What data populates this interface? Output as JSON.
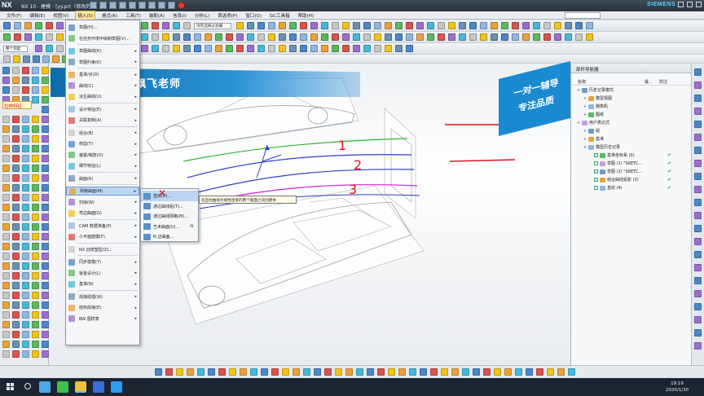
{
  "window": {
    "logo": "NX",
    "title": "NX 10 - 建模 - [yy.prt（修改的）]",
    "brand": "SIEMENS"
  },
  "menubar": {
    "items": [
      {
        "label": "文件(F)"
      },
      {
        "label": "编辑(E)"
      },
      {
        "label": "视图(V)"
      },
      {
        "label": "插入(S)",
        "active": true
      },
      {
        "label": "格式(R)"
      },
      {
        "label": "工具(T)"
      },
      {
        "label": "装配(A)"
      },
      {
        "label": "信息(I)"
      },
      {
        "label": "分析(L)"
      },
      {
        "label": "首选项(P)"
      },
      {
        "label": "窗口(O)"
      },
      {
        "label": "GC工具箱"
      },
      {
        "label": "帮助(H)"
      }
    ]
  },
  "toolbar": {
    "selection_filter": "没有选择过滤器",
    "assembly_scope": "整个装配"
  },
  "leftpalette": {
    "tooltip": "拉伸特征"
  },
  "insert_menu": {
    "items": [
      {
        "label": "草图(H)...",
        "sub": false
      },
      {
        "label": "在任务环境中绘制草图(V)...",
        "sub": false
      },
      {
        "label": "草图曲线(K)",
        "sub": true
      },
      {
        "label": "草图约束(K)",
        "sub": true
      },
      {
        "label": "基准/点(D)",
        "sub": true
      },
      {
        "label": "曲线(C)",
        "sub": true
      },
      {
        "label": "派生曲线(U)",
        "sub": true
      },
      {
        "label": "设计特征(E)",
        "sub": true
      },
      {
        "label": "关联复制(A)",
        "sub": true
      },
      {
        "label": "组合(B)",
        "sub": true
      },
      {
        "label": "修剪(T)",
        "sub": true
      },
      {
        "label": "偏置/缩放(O)",
        "sub": true
      },
      {
        "label": "细节特征(L)",
        "sub": true
      },
      {
        "label": "曲面(R)",
        "sub": true
      },
      {
        "label": "网格曲面(M)",
        "sub": true,
        "highlight": true
      },
      {
        "label": "扫掠(W)",
        "sub": true
      },
      {
        "label": "弯边曲面(G)",
        "sub": true
      },
      {
        "label": "CAM 数据准备(P)",
        "sub": true
      },
      {
        "label": "小平面建模(F)",
        "sub": true
      },
      {
        "label": "NX 创意塑型(Z)...",
        "sub": false
      },
      {
        "label": "同步建模(Y)",
        "sub": true
      },
      {
        "label": "钣金设计(L)",
        "sub": true
      },
      {
        "label": "基准(N)",
        "sub": true
      },
      {
        "label": "焊接助理(W)",
        "sub": true
      },
      {
        "label": "结构焊接(E)",
        "sub": true
      },
      {
        "label": "BW 图样表",
        "sub": true
      }
    ]
  },
  "mesh_submenu": {
    "items": [
      {
        "label": "直纹(R)...",
        "key": "",
        "highlight": true
      },
      {
        "label": "通过曲线组(T)...",
        "key": ""
      },
      {
        "label": "通过曲线网格(M)...",
        "key": ""
      },
      {
        "label": "艺术曲面(U)...",
        "key": "N"
      },
      {
        "label": "N 边曲面..."
      }
    ]
  },
  "tooltip": "在直纹曲线为线性连接的两个截面之间创建体",
  "banner": {
    "left_text": "飘飞老师",
    "right_line1": "一对一辅导",
    "right_line2": "专注品质"
  },
  "annotations": [
    "1",
    "2",
    "3"
  ],
  "navigator": {
    "title": "部件导航器",
    "columns": [
      "名称",
      "最...",
      "附注"
    ],
    "rows": [
      {
        "label": "历史记录模式",
        "indent": 0,
        "ok": false
      },
      {
        "label": "模型视图",
        "indent": 1,
        "ok": false
      },
      {
        "label": "摄像机",
        "indent": 1,
        "ok": false
      },
      {
        "label": "图纸",
        "indent": 1,
        "ok": false
      },
      {
        "label": "用户表达式",
        "indent": 0,
        "ok": false
      },
      {
        "label": "组",
        "indent": 1,
        "ok": false
      },
      {
        "label": "基准",
        "indent": 1,
        "ok": false
      },
      {
        "label": "模型历史记录",
        "indent": 1,
        "ok": false
      },
      {
        "label": "基准坐标系 (0)",
        "indent": 2,
        "ok": true
      },
      {
        "label": "草图 (1) \"SKETC...",
        "indent": 2,
        "ok": true
      },
      {
        "label": "草图 (2) \"SKETC...",
        "indent": 2,
        "ok": true
      },
      {
        "label": "组合曲线投影 (3)",
        "indent": 2,
        "ok": true
      },
      {
        "label": "直纹 (4)",
        "indent": 2,
        "ok": true
      }
    ]
  },
  "taskbar": {
    "time": "19:19",
    "date": "2020/1/30"
  },
  "colors": {
    "curve_green": "#2db82d",
    "curve_blue": "#2c3fc7",
    "curve_magenta": "#d41fd4",
    "annotation_red": "#e0141c",
    "menu_highlight": "#bcd6f2",
    "banner_blue": "#1a8ad1"
  }
}
